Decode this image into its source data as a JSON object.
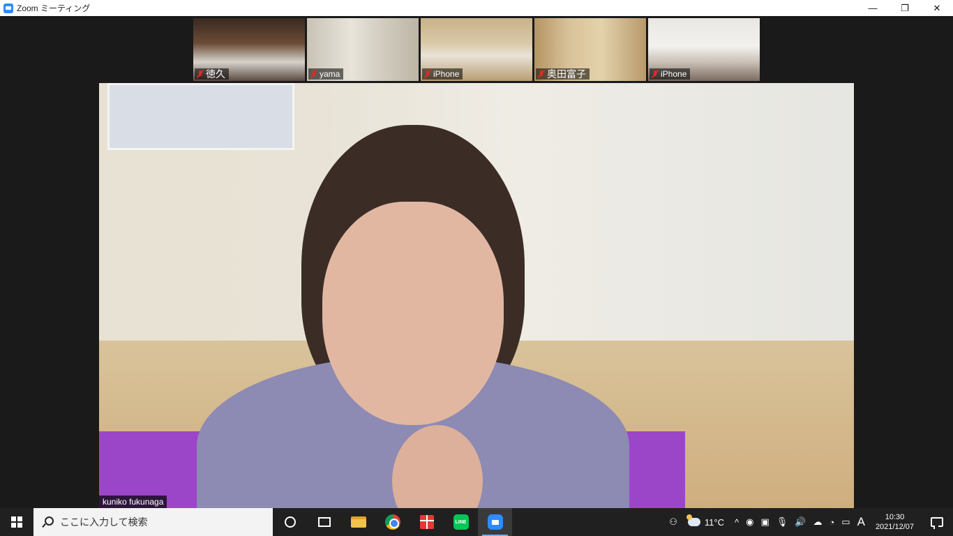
{
  "window": {
    "title": "Zoom ミーティング",
    "controls": {
      "minimize": "—",
      "restore": "❐",
      "close": "✕"
    }
  },
  "participants": [
    {
      "name": "徳久",
      "muted": true
    },
    {
      "name": "yama",
      "muted": true
    },
    {
      "name": "iPhone",
      "muted": true
    },
    {
      "name": "奥田富子",
      "muted": true
    },
    {
      "name": "iPhone",
      "muted": true
    }
  ],
  "active_speaker": {
    "name": "kuniko fukunaga"
  },
  "taskbar": {
    "search_placeholder": "ここに入力して検索",
    "apps": [
      "cortana-icon",
      "task-view-icon",
      "file-explorer-icon",
      "chrome-icon",
      "gift-icon",
      "line-icon",
      "zoom-icon"
    ],
    "line_label": "LINE",
    "tray": {
      "people_icon": "⚇",
      "temperature": "11°C",
      "chevron": "^",
      "ime": "A",
      "clock_time": "10:30",
      "clock_date": "2021/12/07"
    }
  }
}
